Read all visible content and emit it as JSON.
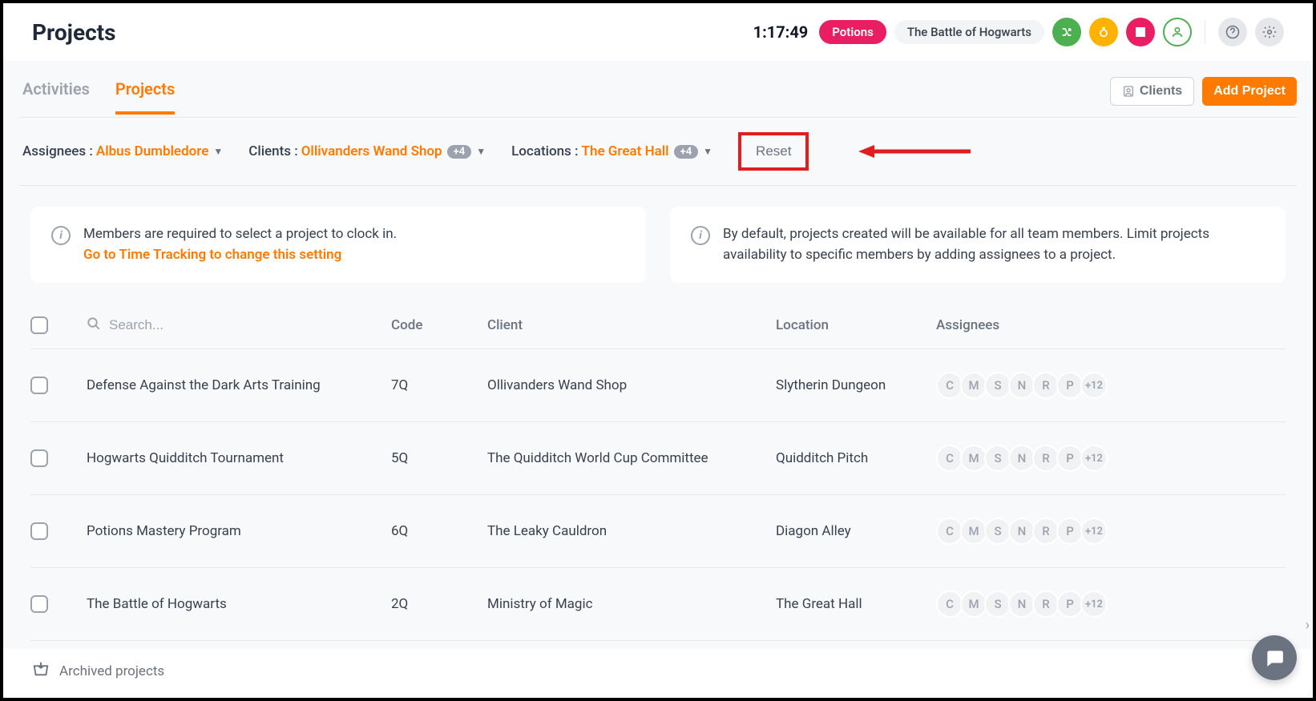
{
  "header": {
    "pageTitle": "Projects",
    "timer": "1:17:49",
    "potionsPill": "Potions",
    "battlePill": "The Battle of Hogwarts"
  },
  "tabs": {
    "activities": "Activities",
    "projects": "Projects",
    "clientsBtn": "Clients",
    "addProjectBtn": "Add Project"
  },
  "filters": {
    "assigneesLabel": "Assignees :",
    "assigneesValue": "Albus Dumbledore",
    "clientsLabel": "Clients :",
    "clientsValue": "Ollivanders Wand Shop",
    "clientsExtra": "+4",
    "locationsLabel": "Locations :",
    "locationsValue": "The Great Hall",
    "locationsExtra": "+4",
    "reset": "Reset"
  },
  "info": {
    "card1line1": "Members are required to select a project to clock in.",
    "card1link": "Go to Time Tracking to change this setting",
    "card2": "By default, projects created will be available for all team members. Limit projects availability to specific members by adding assignees to a project."
  },
  "table": {
    "searchPlaceholder": "Search...",
    "cols": {
      "code": "Code",
      "client": "Client",
      "location": "Location",
      "assignees": "Assignees"
    },
    "avatars": [
      "C",
      "M",
      "S",
      "N",
      "R",
      "P"
    ],
    "more": "+12",
    "rows": [
      {
        "name": "Defense Against the Dark Arts Training",
        "code": "7Q",
        "client": "Ollivanders Wand Shop",
        "location": "Slytherin Dungeon"
      },
      {
        "name": "Hogwarts Quidditch Tournament",
        "code": "5Q",
        "client": "The Quidditch World Cup Committee",
        "location": "Quidditch Pitch"
      },
      {
        "name": "Potions Mastery Program",
        "code": "6Q",
        "client": "The Leaky Cauldron",
        "location": "Diagon Alley"
      },
      {
        "name": "The Battle of Hogwarts",
        "code": "2Q",
        "client": "Ministry of Magic",
        "location": "The Great Hall"
      }
    ]
  },
  "footer": {
    "archived": "Archived projects"
  }
}
